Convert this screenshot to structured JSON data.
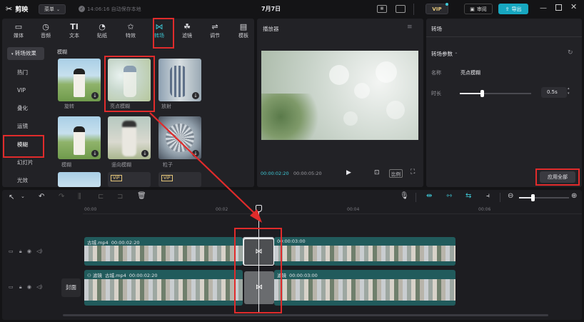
{
  "app": {
    "logo_text": "剪映",
    "menu_label": "菜单",
    "save_status": "14:06:16 自动保存本地",
    "project_title": "7月7日",
    "vip_label": "VIP",
    "review_label": "审阅",
    "export_label": "导出"
  },
  "categories": [
    {
      "label": "媒体",
      "icon": "media-icon",
      "glyph": "▭"
    },
    {
      "label": "音频",
      "icon": "audio-icon",
      "glyph": "◷"
    },
    {
      "label": "文本",
      "icon": "text-icon",
      "glyph": "TI"
    },
    {
      "label": "贴纸",
      "icon": "sticker-icon",
      "glyph": "◔"
    },
    {
      "label": "特效",
      "icon": "effects-icon",
      "glyph": "✩"
    },
    {
      "label": "转场",
      "icon": "transition-icon",
      "glyph": "⋈"
    },
    {
      "label": "滤镜",
      "icon": "filter-icon",
      "glyph": "☘"
    },
    {
      "label": "调节",
      "icon": "adjust-icon",
      "glyph": "⇌"
    },
    {
      "label": "模板",
      "icon": "template-icon",
      "glyph": "▤"
    }
  ],
  "sidebar": {
    "header": "转场效果",
    "items": [
      "热门",
      "VIP",
      "叠化",
      "运镜",
      "模糊",
      "幻灯片",
      "光效"
    ]
  },
  "library": {
    "section_title": "模糊",
    "items": [
      "旋转",
      "亮点模糊",
      "放射",
      "模糊",
      "竖向模糊",
      "粒子"
    ]
  },
  "player": {
    "title": "播放器",
    "current_time": "00:00:02:20",
    "total_time": "00:00:05:20",
    "ratio_label": "比例"
  },
  "inspector": {
    "tab": "转场",
    "section": "转场参数",
    "name_label": "名称",
    "name_value": "亮点模糊",
    "duration_label": "时长",
    "duration_value": "0.5s",
    "duration_slider_fraction": 0.5,
    "apply_all_label": "应用全部"
  },
  "timeline": {
    "ruler": [
      "00:00",
      "00:02",
      "00:04",
      "00:06"
    ],
    "tracks": [
      {
        "clip1_name": "古城.mp4",
        "clip1_time": "00:00:02:20",
        "clip2_time": "00:00:03:00"
      },
      {
        "clip1_prefix": "滤镜",
        "clip1_name": "古城.mp4",
        "clip1_time": "00:00:02:20",
        "clip2_prefix": "滤镜",
        "clip2_time": "00:00:03:00"
      }
    ],
    "cover_label": "封面",
    "zoom_fraction": 0.5
  },
  "colors": {
    "accent": "#3ec8d6",
    "highlight_box": "#e02b2b",
    "export_bg": "#17a7c0"
  }
}
